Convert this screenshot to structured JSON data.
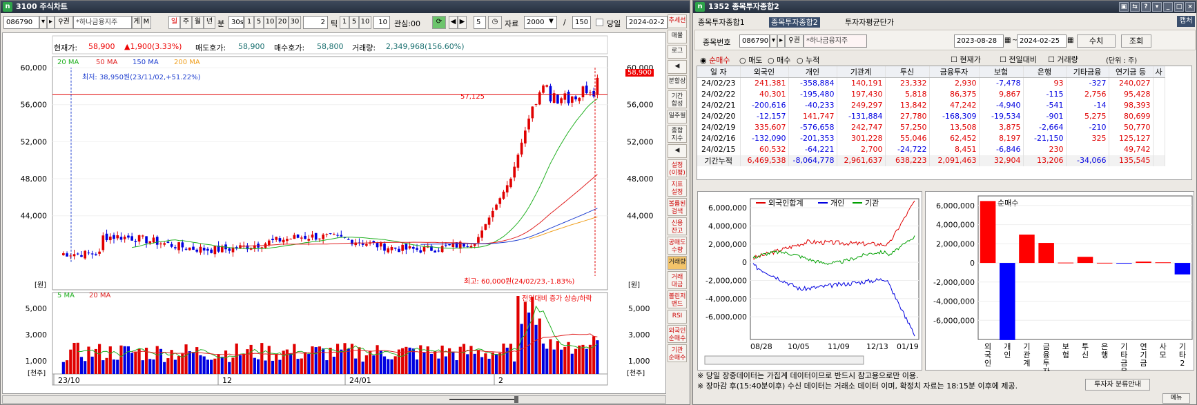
{
  "left": {
    "title": "3100 주식차트",
    "logo": "n",
    "code": "086790",
    "name": "*하나금융지주",
    "ge": "게",
    "m": "M",
    "periods": [
      "일",
      "주",
      "월",
      "년",
      "분"
    ],
    "min30": "30s",
    "minbtns": [
      "1",
      "5",
      "10",
      "20",
      "30"
    ],
    "tick_val": "2",
    "tick_label": "틱",
    "tickbtns": [
      "1",
      "5",
      "10"
    ],
    "tick_input": "10",
    "gwansim": "관심:00",
    "five": "5",
    "jaryo_label": "자료",
    "jaryo_val": "2000",
    "slash": "/",
    "count": "150",
    "dangil": "당일",
    "date": "2024-02-2",
    "info": {
      "cur_label": "현재가:",
      "cur": "58,900",
      "chg": "▲1,900(3.33%)",
      "ask_label": "매도호가:",
      "ask": "58,900",
      "bid_label": "매수호가:",
      "bid": "58,800",
      "vol_label": "거래량:",
      "vol": "2,349,968(156.60%)"
    },
    "ma_legend": [
      {
        "label": "20 MA",
        "color": "#20b020"
      },
      {
        "label": "50 MA",
        "color": "#e02020"
      },
      {
        "label": "150 MA",
        "color": "#2040d0"
      },
      {
        "label": "200 MA",
        "color": "#f0a020"
      }
    ],
    "low_note": "최저: 38,950원(23/11/02,+51.22%)",
    "high_note": "최고: 60,000원(24/02/23,-1.83%)",
    "hline_label": "57,125",
    "price_tag": "58,900",
    "won": "[원]",
    "y_ticks": [
      "60,000",
      "56,000",
      "52,000",
      "48,000",
      "44,000"
    ],
    "vol_legend": [
      {
        "label": "5 MA",
        "color": "#20b020"
      },
      {
        "label": "20 MA",
        "color": "#e02020"
      }
    ],
    "vol_note": "전일대비 증가 상승/하락",
    "vol_ticks": [
      "5,000",
      "3,000",
      "1,000"
    ],
    "thousand": "[천주]",
    "x_ticks": [
      "23/10",
      "12",
      "24/01",
      "2"
    ]
  },
  "sidebar": [
    {
      "label": "추세선",
      "hl": true
    },
    {
      "label": "매물",
      "hl": false
    },
    {
      "label": "로그",
      "hl": false
    },
    {
      "label": "◀",
      "hl": false
    },
    {
      "label": "분할상",
      "hl": false
    },
    {
      "label": "기간\n합성",
      "hl": false
    },
    {
      "label": "일주월",
      "hl": false
    },
    {
      "label": "종합\n지수",
      "hl": false
    },
    {
      "label": "◀",
      "hl": false
    },
    {
      "label": "설정\n(이평)",
      "hl": true
    },
    {
      "label": "지표\n설정",
      "hl": true
    },
    {
      "label": "볼륨된\n검색",
      "hl": true
    },
    {
      "label": "신용\n잔고",
      "hl": true
    },
    {
      "label": "공매도\n수량",
      "hl": true
    },
    {
      "label": "거래량",
      "hl": false,
      "act": true
    },
    {
      "label": "거래\n대금",
      "hl": true
    },
    {
      "label": "볼린저\n밴드",
      "hl": true
    },
    {
      "label": "RSI",
      "hl": true
    },
    {
      "label": "외국인\n순매수",
      "hl": true
    },
    {
      "label": "기관\n순매수",
      "hl": true
    }
  ],
  "right": {
    "title": "1352 종목투자종합2",
    "logo": "n",
    "tabs": [
      "종목투자종합1",
      "종목투자종합2",
      "투자자평균단가"
    ],
    "side_tab": "캡처",
    "code_label": "종목번호",
    "code": "086790",
    "name": "*하나금융지주",
    "date_from": "2023-08-28",
    "date_to": "2024-02-25",
    "btn_suchi": "수치",
    "btn_johoe": "조회",
    "radios": [
      "순매수",
      "매도",
      "매수",
      "누적"
    ],
    "checks": [
      "현재가",
      "전일대비",
      "거래량"
    ],
    "unit": "(단위 : 주)",
    "table": {
      "headers": [
        "일 자",
        "외국인",
        "개인",
        "기관계",
        "투신",
        "금융투자",
        "보험",
        "은행",
        "기타금융",
        "연기금 등",
        "사"
      ],
      "rows": [
        [
          "24/02/23",
          "241,381",
          "-358,884",
          "140,191",
          "23,332",
          "2,930",
          "-7,478",
          "93",
          "-327",
          "240,027"
        ],
        [
          "24/02/22",
          "40,301",
          "-195,480",
          "197,430",
          "5,818",
          "86,375",
          "9,867",
          "-115",
          "2,756",
          "95,428"
        ],
        [
          "24/02/21",
          "-200,616",
          "-40,233",
          "249,297",
          "13,842",
          "47,242",
          "-4,940",
          "-541",
          "-14",
          "98,393"
        ],
        [
          "24/02/20",
          "-12,157",
          "141,747",
          "-131,884",
          "27,780",
          "-168,309",
          "-19,534",
          "-901",
          "5,275",
          "80,699"
        ],
        [
          "24/02/19",
          "335,607",
          "-576,658",
          "242,747",
          "57,250",
          "13,508",
          "3,875",
          "-2,664",
          "-210",
          "50,770"
        ],
        [
          "24/02/16",
          "-132,090",
          "-201,353",
          "301,228",
          "55,046",
          "62,452",
          "8,197",
          "-21,150",
          "325",
          "125,127"
        ],
        [
          "24/02/15",
          "60,532",
          "-64,221",
          "2,700",
          "-24,722",
          "8,451",
          "-6,846",
          "230",
          "",
          "49,742"
        ],
        [
          "기간누적",
          "6,469,538",
          "-8,064,778",
          "2,961,637",
          "638,223",
          "2,091,463",
          "32,904",
          "13,206",
          "-34,066",
          "135,545"
        ]
      ]
    },
    "line_chart": {
      "legend": [
        {
          "label": "외국인합계",
          "color": "#e00000"
        },
        {
          "label": "개인",
          "color": "#0000e0"
        },
        {
          "label": "기관",
          "color": "#00a000"
        }
      ],
      "y_ticks": [
        "6,000,000",
        "4,000,000",
        "2,000,000",
        "0",
        "-2,000,000",
        "-4,000,000",
        "-6,000,000"
      ],
      "x_ticks": [
        "08/28",
        "10/05",
        "11/09",
        "12/13",
        "01/19"
      ]
    },
    "bar_chart": {
      "title": "순매수",
      "y_ticks": [
        "6,000,000",
        "4,000,000",
        "2,000,000",
        "0",
        "-2,000,000",
        "-4,000,000",
        "-6,000,000"
      ],
      "categories": [
        "외국인",
        "개인",
        "기관계",
        "금융투자",
        "보험",
        "투신",
        "은행",
        "기타금융",
        "연기금",
        "사모",
        "기타2"
      ]
    },
    "notes": [
      "※ 당일 장중데이터는 가집계 데이터이므로 반드시 참고용으로만 이용.",
      "※ 장마감 후(15:40분이후) 수신 데이터는 거래소 데이터 이며, 확정치 자료는 18:15분 이후에 제공."
    ],
    "btn_info": "투자자 분류안내",
    "menu": "메뉴"
  },
  "chart_data": [
    {
      "type": "bar",
      "title": "순매수",
      "categories": [
        "외국인",
        "개인",
        "기관계",
        "금융투자",
        "보험",
        "투신",
        "은행",
        "기타금융",
        "연기금",
        "사모",
        "기타2"
      ],
      "values": [
        6469538,
        -8064778,
        2961637,
        2091463,
        32904,
        638223,
        13206,
        -34066,
        135545,
        60000,
        -1200000
      ],
      "ylim": [
        -8000000,
        7000000
      ]
    }
  ]
}
